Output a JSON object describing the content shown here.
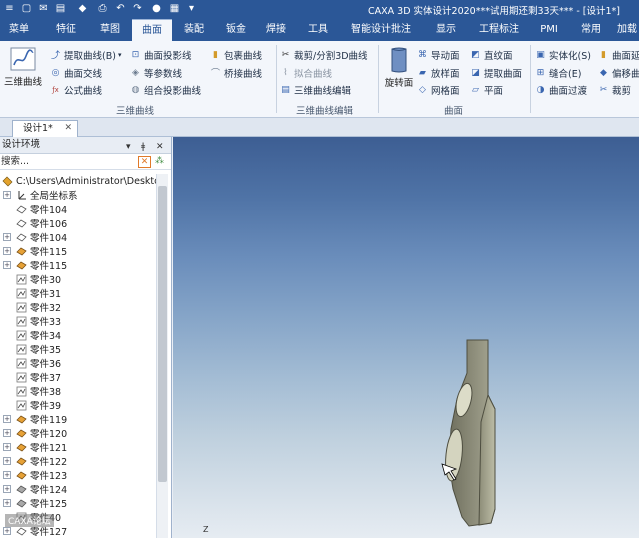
{
  "app_title": "CAXA 3D 实体设计2020***试用期还剩33天*** - [设计1*]",
  "menu_tabs": [
    "菜单",
    "特征",
    "草图",
    "曲面",
    "装配",
    "钣金",
    "焊接",
    "工具",
    "智能设计批注",
    "显示",
    "工程标注",
    "PMI",
    "常用",
    "加载"
  ],
  "active_tab": "曲面",
  "ribbon": {
    "big_button": "三维曲线",
    "col1": [
      "提取曲线(B)",
      "曲面交线",
      "公式曲线"
    ],
    "col2": [
      "曲面投影线",
      "等参数线",
      "组合投影曲线"
    ],
    "col3": [
      "包裹曲线",
      "桥接曲线"
    ],
    "group1_label": "三维曲线",
    "col4": [
      "裁剪/分割3D曲线",
      "拟合曲线",
      "三维曲线编辑"
    ],
    "group2_label": "三维曲线编辑",
    "rotate_button": "旋转面",
    "col5": [
      "导动面",
      "放样面",
      "网格面"
    ],
    "col6": [
      "直纹面",
      "提取曲面",
      "平面"
    ],
    "group3_label": "曲面",
    "col7": [
      "实体化(S)",
      "缝合(E)",
      "曲面过渡"
    ],
    "col8": [
      "曲面延",
      "偏移曲",
      "裁剪"
    ]
  },
  "doc_tab": "设计1*",
  "panel": {
    "title": "设计环境",
    "search_placeholder": "搜索...",
    "tree": [
      {
        "label": "C:\\Users\\Administrator\\Desktop",
        "icon": "design-root"
      },
      {
        "label": "全局坐标系",
        "icon": "axis"
      },
      {
        "label": "零件104",
        "icon": "part-hollow"
      },
      {
        "label": "零件106",
        "icon": "part-hollow"
      },
      {
        "label": "零件104",
        "icon": "part-hollow"
      },
      {
        "label": "零件115",
        "icon": "part-solid"
      },
      {
        "label": "零件115",
        "icon": "part-solid"
      },
      {
        "label": "零件30",
        "icon": "sketch"
      },
      {
        "label": "零件31",
        "icon": "sketch"
      },
      {
        "label": "零件32",
        "icon": "sketch"
      },
      {
        "label": "零件33",
        "icon": "sketch"
      },
      {
        "label": "零件34",
        "icon": "sketch"
      },
      {
        "label": "零件35",
        "icon": "sketch"
      },
      {
        "label": "零件36",
        "icon": "sketch"
      },
      {
        "label": "零件37",
        "icon": "sketch"
      },
      {
        "label": "零件38",
        "icon": "sketch"
      },
      {
        "label": "零件39",
        "icon": "sketch"
      },
      {
        "label": "零件119",
        "icon": "part-solid"
      },
      {
        "label": "零件120",
        "icon": "part-solid"
      },
      {
        "label": "零件121",
        "icon": "part-solid"
      },
      {
        "label": "零件122",
        "icon": "part-solid"
      },
      {
        "label": "零件123",
        "icon": "part-solid"
      },
      {
        "label": "零件124",
        "icon": "part-gray"
      },
      {
        "label": "零件125",
        "icon": "part-gray"
      },
      {
        "label": "零件40",
        "icon": "sketch"
      },
      {
        "label": "零件127",
        "icon": "part-hollow"
      }
    ],
    "watermark": "CAXA论坛"
  },
  "viewport": {
    "axis_label": "Z"
  }
}
